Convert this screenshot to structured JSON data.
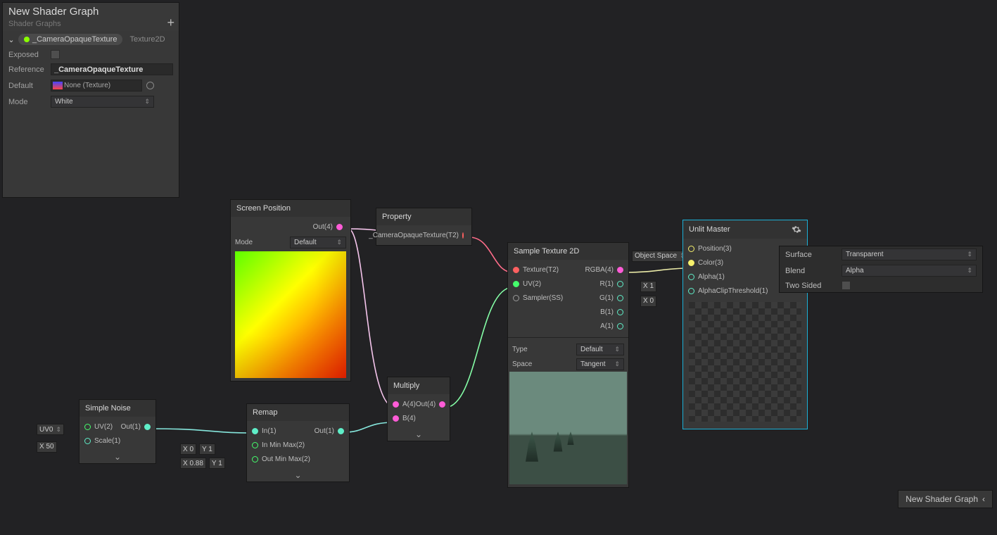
{
  "blackboard": {
    "title": "New Shader Graph",
    "subtitle": "Shader Graphs",
    "prop_name": "_CameraOpaqueTexture",
    "prop_type": "Texture2D",
    "exposed_label": "Exposed",
    "reference_label": "Reference",
    "reference_value": "_CameraOpaqueTexture",
    "default_label": "Default",
    "default_value": "None (Texture)",
    "mode_label": "Mode",
    "mode_value": "White"
  },
  "nodes": {
    "screenPos": {
      "title": "Screen Position",
      "out": "Out(4)",
      "mode_label": "Mode",
      "mode_value": "Default"
    },
    "property": {
      "title": "Property",
      "out": "_CameraOpaqueTexture(T2)"
    },
    "multiply": {
      "title": "Multiply",
      "a": "A(4)",
      "b": "B(4)",
      "out": "Out(4)"
    },
    "simpleNoise": {
      "title": "Simple Noise",
      "uv_lbl": "UV(2)",
      "scale_lbl": "Scale(1)",
      "out": "Out(1)",
      "uv_in": "UV0",
      "scale_in": "X 50"
    },
    "remap": {
      "title": "Remap",
      "in": "In(1)",
      "inmm": "In Min Max(2)",
      "outmm": "Out Min Max(2)",
      "out": "Out(1)",
      "imm_x": "X 0",
      "imm_y": "Y 1",
      "omm_x": "X 0.88",
      "omm_y": "Y 1"
    },
    "sample": {
      "title": "Sample Texture 2D",
      "tex": "Texture(T2)",
      "uv": "UV(2)",
      "sampler": "Sampler(SS)",
      "rgba": "RGBA(4)",
      "r": "R(1)",
      "g": "G(1)",
      "b": "B(1)",
      "a": "A(1)",
      "type_label": "Type",
      "type_value": "Default",
      "space_label": "Space",
      "space_value": "Tangent"
    },
    "master": {
      "title": "Unlit Master",
      "pos": "Position(3)",
      "color": "Color(3)",
      "alpha": "Alpha(1)",
      "clip": "AlphaClipThreshold(1)",
      "space_pill": "Object Space",
      "alpha_in": "X 1",
      "clip_in": "X 0"
    }
  },
  "inspector": {
    "surface_label": "Surface",
    "surface_value": "Transparent",
    "blend_label": "Blend",
    "blend_value": "Alpha",
    "twosided_label": "Two Sided"
  },
  "preview_button": "New Shader Graph"
}
